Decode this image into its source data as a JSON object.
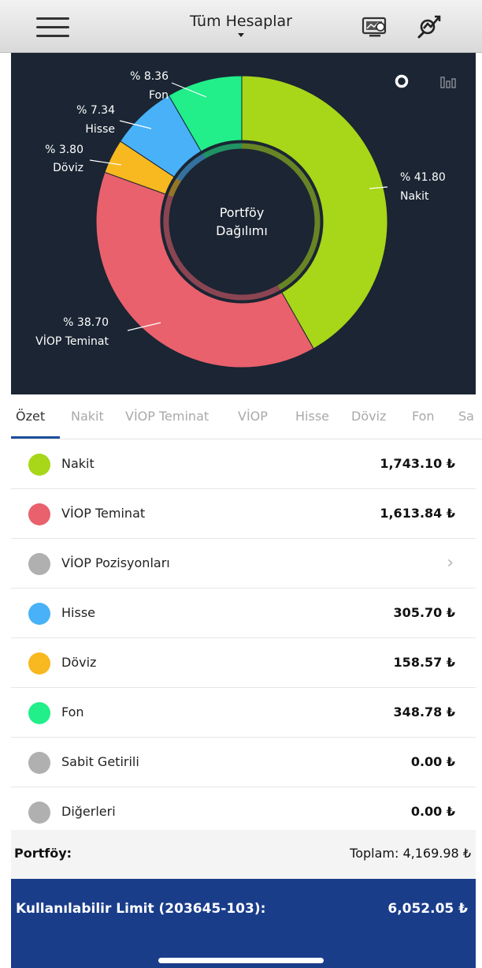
{
  "header": {
    "account_selector": "Tüm Hesaplar",
    "icons": {
      "menu": "hamburger-menu-icon",
      "screen": "market-screen-icon",
      "analysis": "analysis-icon"
    }
  },
  "chart": {
    "center_label_line1": "Portföy",
    "center_label_line2": "Dağılımı",
    "toggle_icons": [
      "donut-chart-icon",
      "bar-chart-icon"
    ]
  },
  "chart_data": {
    "type": "pie",
    "style": "donut",
    "title": "Portföy Dağılımı",
    "slices": [
      {
        "label": "Nakit",
        "percent_label": "% 41.80",
        "value": 41.8,
        "color": "#a8d619"
      },
      {
        "label": "VİOP Teminat",
        "percent_label": "% 38.70",
        "value": 38.7,
        "color": "#e8616c"
      },
      {
        "label": "Döviz",
        "percent_label": "% 3.80",
        "value": 3.8,
        "color": "#f8b81f"
      },
      {
        "label": "Hisse",
        "percent_label": "% 7.34",
        "value": 7.34,
        "color": "#48b1f7"
      },
      {
        "label": "Fon",
        "percent_label": "% 8.36",
        "value": 8.36,
        "color": "#22ee8a"
      }
    ]
  },
  "tabs": [
    "Özet",
    "Nakit",
    "VİOP Teminat",
    "VİOP",
    "Hisse",
    "Döviz",
    "Fon",
    "Sa"
  ],
  "active_tab": "Özet",
  "rows": [
    {
      "label": "Nakit",
      "amount": "1,743.10 ₺",
      "color": "#a8d619"
    },
    {
      "label": "VİOP Teminat",
      "amount": "1,613.84 ₺",
      "color": "#e8616c"
    },
    {
      "label": "VİOP Pozisyonları",
      "amount": "",
      "chevron": "›",
      "color": "#b0b0b0"
    },
    {
      "label": "Hisse",
      "amount": "305.70 ₺",
      "color": "#48b1f7"
    },
    {
      "label": "Döviz",
      "amount": "158.57 ₺",
      "color": "#f8b81f"
    },
    {
      "label": "Fon",
      "amount": "348.78 ₺",
      "color": "#22ee8a"
    },
    {
      "label": "Sabit Getirili",
      "amount": "0.00 ₺",
      "color": "#b0b0b0"
    },
    {
      "label": "Diğerleri",
      "amount": "0.00 ₺",
      "color": "#b0b0b0"
    }
  ],
  "portfolio": {
    "label": "Portföy:",
    "total": "Toplam: 4,169.98 ₺"
  },
  "limit": {
    "label": "Kullanılabilir Limit (203645-103):",
    "value": "6,052.05 ₺"
  }
}
